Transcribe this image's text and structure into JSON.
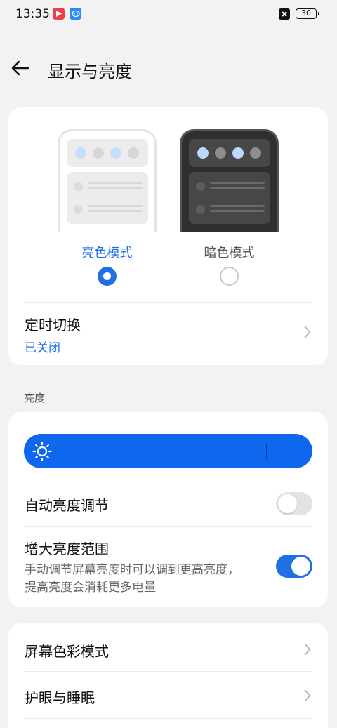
{
  "status_bar": {
    "time": "13:35",
    "battery": "30",
    "icons": [
      "video-app-icon",
      "chat-app-icon",
      "notification-x-icon",
      "battery-icon"
    ]
  },
  "header": {
    "title": "显示与亮度",
    "back_icon": "back-arrow-icon"
  },
  "display_mode": {
    "light_label": "亮色模式",
    "dark_label": "暗色模式",
    "selected": "light",
    "schedule": {
      "title": "定时切换",
      "status": "已关闭"
    }
  },
  "brightness": {
    "section_label": "亮度",
    "level_percent": 84,
    "auto": {
      "title": "自动亮度调节",
      "enabled": false
    },
    "extended": {
      "title": "增大亮度范围",
      "description": "手动调节屏幕亮度时可以调到更高亮度，提高亮度会消耗更多电量",
      "enabled": true
    }
  },
  "more": {
    "items": [
      {
        "label": "屏幕色彩模式"
      },
      {
        "label": "护眼与睡眠"
      }
    ]
  },
  "colors": {
    "accent": "#1f6fe5",
    "slider": "#0f67ee",
    "background": "#f2f2f2"
  }
}
